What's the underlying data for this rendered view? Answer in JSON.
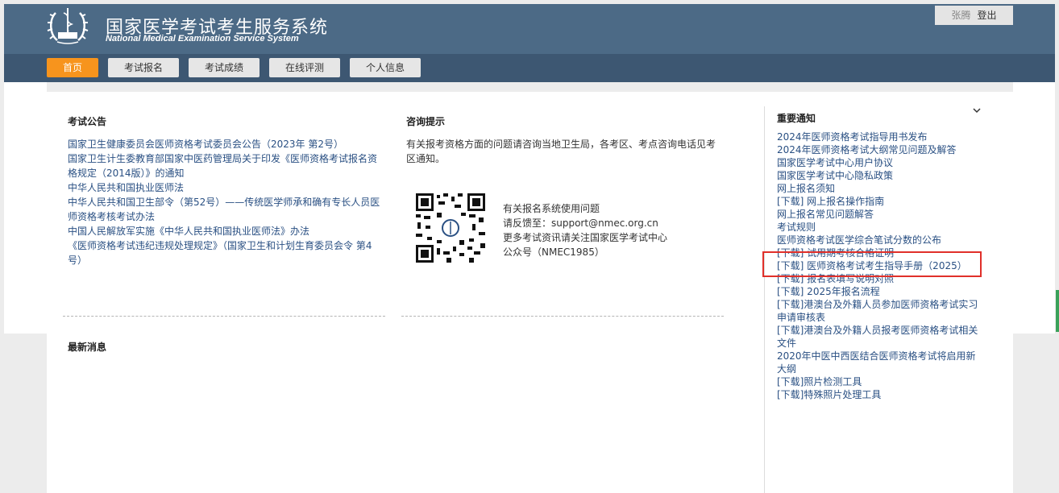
{
  "header": {
    "title": "国家医学考试考生服务系统",
    "subtitle": "National Medical Examination Service System",
    "logo_icon": "caduceus-emblem-icon",
    "username": "张腾",
    "logout_label": "登出"
  },
  "nav": {
    "items": [
      {
        "label": "首页",
        "active": true
      },
      {
        "label": "考试报名",
        "active": false
      },
      {
        "label": "考试成绩",
        "active": false
      },
      {
        "label": "在线评测",
        "active": false
      },
      {
        "label": "个人信息",
        "active": false
      }
    ]
  },
  "announcements": {
    "title": "考试公告",
    "lines": [
      "国家卫生健康委员会医师资格考试委员会公告（2023年 第2号）",
      "国家卫生计生委教育部国家中医药管理局关于印发《医师资格考试报名资",
      "格规定（2014版）》的通知",
      "中华人民共和国执业医师法",
      "中华人民共和国卫生部令（第52号）——传统医学师承和确有专长人员医",
      "师资格考核考试办法",
      "中国人民解放军实施《中华人民共和国执业医师法》办法",
      "《医师资格考试违纪违规处理规定》（国家卫生和计划生育委员会令 第4",
      "号）"
    ]
  },
  "consult": {
    "title": "咨询提示",
    "text_line1": "有关报考资格方面的问题请咨询当地卫生局，各考区、考点咨询电话见考",
    "text_line2": "区通知。",
    "qr_icon": "qr-code-icon",
    "info_lines": [
      "有关报名系统使用问题",
      "请反馈至：support@nmec.org.cn",
      "更多考试资讯请关注国家医学考试中心",
      "公众号（NMEC1985）"
    ]
  },
  "latest": {
    "title": "最新消息"
  },
  "important": {
    "title": "重要通知",
    "collapse_icon": "chevron-down-icon",
    "lines": [
      "2024年医师资格考试指导用书发布",
      "2024年医师资格考试大纲常见问题及解答",
      "国家医学考试中心用户协议",
      "国家医学考试中心隐私政策",
      "网上报名须知",
      "[下载] 网上报名操作指南",
      "网上报名常见问题解答",
      "考试规则",
      "医师资格考试医学综合笔试分数的公布",
      "[下载] 试用期考核合格证明",
      "[下载] 医师资格考试考生指导手册（2025）",
      "[下载] 报名表填写说明对照",
      "[下载] 2025年报名流程",
      "[下载]港澳台及外籍人员参加医师资格考试实习",
      "申请审核表",
      "[下载]港澳台及外籍人员报考医师资格考试相关",
      "文件",
      "2020年中医中西医结合医师资格考试将启用新",
      "大纲",
      "[下载]照片检测工具",
      "[下载]特殊照片处理工具"
    ]
  },
  "colors": {
    "header_bg": "#4c6a86",
    "nav_bg": "#3d5772",
    "active_tab": "#f7941d",
    "link": "#2a5083",
    "highlight": "#e0302a"
  }
}
